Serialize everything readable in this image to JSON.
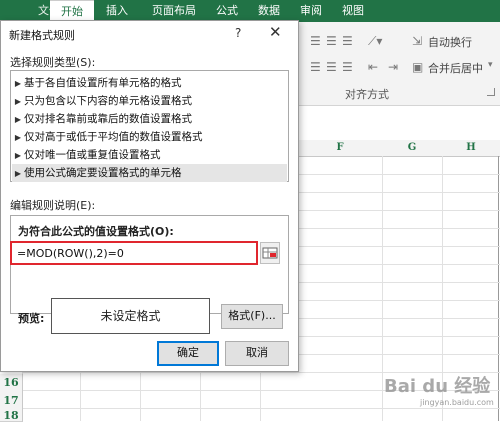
{
  "ribbon": {
    "tabs": [
      "文件",
      "开始",
      "插入",
      "页面布局",
      "公式",
      "数据",
      "审阅",
      "视图"
    ],
    "active_tab": "开始",
    "wrap_text": "自动换行",
    "merge_center": "合并后居中",
    "alignment_group": "对齐方式"
  },
  "grid": {
    "columns": [
      "F",
      "G",
      "H"
    ],
    "rows": [
      "16",
      "17",
      "18"
    ]
  },
  "dialog": {
    "title": "新建格式规则",
    "help": "?",
    "close": "✕",
    "select_type_label": "选择规则类型(S):",
    "rule_types": [
      "基于各自值设置所有单元格的格式",
      "只为包含以下内容的单元格设置格式",
      "仅对排名靠前或靠后的数值设置格式",
      "仅对高于或低于平均值的数值设置格式",
      "仅对唯一值或重复值设置格式",
      "使用公式确定要设置格式的单元格"
    ],
    "selected_rule_index": 5,
    "edit_desc_label": "编辑规则说明(E):",
    "formula_label": "为符合此公式的值设置格式(O):",
    "formula_value": "=MOD(ROW(),2)=0",
    "preview_label": "预览:",
    "preview_text": "未设定格式",
    "format_button": "格式(F)...",
    "ok_button": "确定",
    "cancel_button": "取消"
  },
  "watermark": {
    "brand": "Bai du 经验",
    "url": "jingyan.baidu.com"
  },
  "colors": {
    "excel_green": "#217346",
    "highlight_red": "#e0262e",
    "button_focus": "#0078d7"
  }
}
